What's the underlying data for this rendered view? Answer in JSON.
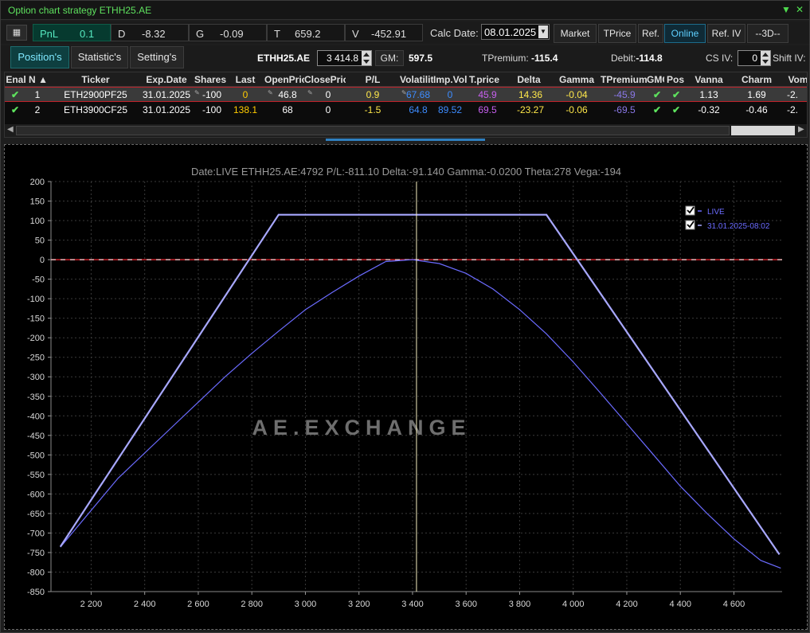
{
  "window": {
    "title": "Option chart strategy ETHH25.AE"
  },
  "toolbar": {
    "pnl_label": "PnL",
    "pnl_value": "0.1",
    "d_label": "D",
    "d_value": "-8.32",
    "g_label": "G",
    "g_value": "-0.09",
    "t_label": "T",
    "t_value": "659.2",
    "v_label": "V",
    "v_value": "-452.91",
    "calc_label": "Calc Date:",
    "calc_date": "08.01.2025",
    "market": "Market",
    "tprice": "TPrice",
    "ref": "Ref.",
    "online": "Online",
    "ref_iv": "Ref. IV",
    "three_d": "--3D--"
  },
  "tabs": {
    "positions": "Position's",
    "statistics": "Statistic's",
    "settings": "Setting's"
  },
  "info": {
    "symbol": "ETHH25.AE",
    "price": "3 414.8",
    "gm_button": "GM:",
    "gm_value": "597.5",
    "tpremium_label": "TPremium:",
    "tpremium_value": "-115.4",
    "debit_label": "Debit:",
    "debit_value": "-114.8",
    "csiv_label": "CS IV:",
    "csiv_value": "0",
    "shiftiv_label": "Shift IV:"
  },
  "table": {
    "headers": [
      "Enal",
      "N",
      "Ticker",
      "Exp.Date",
      "Shares",
      "Last",
      "OpenPrice",
      "ClosePrice",
      "P/L",
      "Volatility",
      "Imp.Vol",
      "T.price",
      "Delta",
      "Gamma",
      "TPremium",
      "GMC",
      "Pos",
      "Vanna",
      "Charm",
      "Vom"
    ],
    "rows": [
      {
        "n": "1",
        "ticker": "ETH2900PF25",
        "exp": "31.01.2025",
        "shares": "-100",
        "last": "0",
        "open": "46.8",
        "close": "0",
        "pl": "0.9",
        "vol": "67.68",
        "impvol": "0",
        "tprice": "45.9",
        "delta": "14.36",
        "gamma": "-0.04",
        "tpremium": "-45.9",
        "vanna": "1.13",
        "charm": "1.69",
        "vomma": "-2."
      },
      {
        "n": "2",
        "ticker": "ETH3900CF25",
        "exp": "31.01.2025",
        "shares": "-100",
        "last": "138.1",
        "open": "68",
        "close": "0",
        "pl": "-1.5",
        "vol": "64.8",
        "impvol": "89.52",
        "tprice": "69.5",
        "delta": "-23.27",
        "gamma": "-0.06",
        "tpremium": "-69.5",
        "vanna": "-0.32",
        "charm": "-0.46",
        "vomma": "-2."
      }
    ]
  },
  "chart_data": {
    "type": "line",
    "title": "Date:LIVE  ETHH25.AE:4792  P/L:-811.10  Delta:-91.140  Gamma:-0.0200  Theta:278  Vega:-194",
    "watermark": "AE.EXCHANGE",
    "xlim": [
      2050,
      4780
    ],
    "ylim": [
      -850,
      200
    ],
    "x_ticks": [
      2200,
      2400,
      2600,
      2800,
      3000,
      3200,
      3400,
      3600,
      3800,
      4000,
      4200,
      4400,
      4600
    ],
    "x_tick_labels": [
      "2 200",
      "2 400",
      "2 600",
      "2 800",
      "3 000",
      "3 200",
      "3 400",
      "3 600",
      "3 800",
      "4 000",
      "4 200",
      "4 400",
      "4 600"
    ],
    "y_ticks": [
      200,
      150,
      100,
      50,
      0,
      -50,
      -100,
      -150,
      -200,
      -250,
      -300,
      -350,
      -400,
      -450,
      -500,
      -550,
      -600,
      -650,
      -700,
      -750,
      -800,
      -850
    ],
    "current_price": 3414.8,
    "zero_line_color": "#c8202a",
    "grid": true,
    "legend_position": "top-right",
    "series": [
      {
        "name": "LIVE",
        "color": "#6b6bff",
        "x": [
          2085,
          2300,
          2500,
          2700,
          2800,
          2900,
          3000,
          3100,
          3200,
          3300,
          3400,
          3500,
          3600,
          3700,
          3800,
          3900,
          4000,
          4100,
          4200,
          4300,
          4400,
          4500,
          4600,
          4700,
          4775
        ],
        "y": [
          -736,
          -560,
          -430,
          -300,
          -240,
          -183,
          -128,
          -84,
          -42,
          -5,
          0,
          -10,
          -35,
          -75,
          -128,
          -190,
          -262,
          -340,
          -420,
          -500,
          -580,
          -650,
          -715,
          -770,
          -790
        ]
      },
      {
        "name": "31.01.2025-08:02",
        "color": "#a8a8ff",
        "x": [
          2085,
          2900,
          3900,
          4770
        ],
        "y": [
          -735,
          115,
          115,
          -755
        ]
      }
    ]
  }
}
